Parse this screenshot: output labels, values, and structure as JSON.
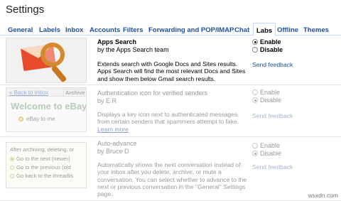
{
  "page": {
    "title": "Settings"
  },
  "tabs": [
    {
      "label": "General",
      "active": false
    },
    {
      "label": "Labels",
      "active": false
    },
    {
      "label": "Inbox",
      "active": false
    },
    {
      "label": "Accounts",
      "active": false
    },
    {
      "label": "Filters",
      "active": false
    },
    {
      "label": "Forwarding and POP/IMAP",
      "active": false
    },
    {
      "label": "Chat",
      "active": false
    },
    {
      "label": "Labs",
      "active": true
    },
    {
      "label": "Offline",
      "active": false
    },
    {
      "label": "Themes",
      "active": false
    }
  ],
  "labs": [
    {
      "name": "Apps Search",
      "author": "by the Apps Search team",
      "description": "Extends search with Google Docs and Sites results. Apps Search will find the most relevant Docs and Sites and show them below Gmail search results.",
      "enable_label": "Enable",
      "disable_label": "Disable",
      "selected": "enable",
      "feedback": "Send feedback",
      "dimmed": false
    },
    {
      "name": "Authentication icon for verified senders",
      "author": "by E R",
      "description": "Displays a key icon next to authenticated messages from certain senders that spammers attempt to fake.",
      "learn_more": "Learn more",
      "enable_label": "Enable",
      "disable_label": "Disable",
      "selected": "disable",
      "feedback": "Send feedback",
      "dimmed": true,
      "thumb": {
        "back_link": "« Back to Inbox",
        "archive": "Archive",
        "welcome": "Welcome to eBay!",
        "ebay_to": "eBay to me"
      }
    },
    {
      "name": "Auto-advance",
      "author": "by Bruce D",
      "description": "Automatically shows the next conversation instead of your inbox after you delete, archive, or mute a conversation. You can select whether to advance to the next or previous conversation in the \"General\" Settings page.",
      "enable_label": "Enable",
      "disable_label": "Disable",
      "selected": "disable",
      "feedback": "Send feedback",
      "dimmed": true,
      "thumb": {
        "title": "After archiving, deleting, or",
        "options": [
          "Go to the next (newer)",
          "Go to the previous (old",
          "Go back to the threadlis"
        ]
      }
    }
  ],
  "watermark": "wsxdn.com"
}
